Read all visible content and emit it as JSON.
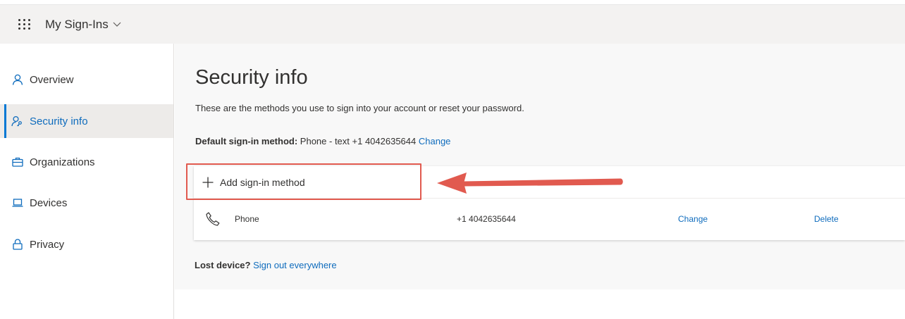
{
  "header": {
    "app_title": "My Sign-Ins"
  },
  "sidebar": {
    "items": [
      {
        "label": "Overview",
        "icon": "person-icon",
        "active": false
      },
      {
        "label": "Security info",
        "icon": "person-key-icon",
        "active": true
      },
      {
        "label": "Organizations",
        "icon": "briefcase-icon",
        "active": false
      },
      {
        "label": "Devices",
        "icon": "laptop-icon",
        "active": false
      },
      {
        "label": "Privacy",
        "icon": "lock-icon",
        "active": false
      }
    ]
  },
  "main": {
    "title": "Security info",
    "subtitle": "These are the methods you use to sign into your account or reset your password.",
    "default_method": {
      "label": "Default sign-in method:",
      "value": "Phone - text +1 4042635644",
      "change_link": "Change"
    },
    "add_method_label": "Add sign-in method",
    "methods": [
      {
        "icon": "phone-icon",
        "type": "Phone",
        "value": "+1 4042635644",
        "change": "Change",
        "delete": "Delete"
      }
    ],
    "lost_device": {
      "label": "Lost device?",
      "link": "Sign out everywhere"
    }
  },
  "annotation": {
    "highlight_color": "#e15a4f",
    "arrow_color": "#e15a4f"
  },
  "colors": {
    "accent": "#0078d4",
    "link": "#0f6cbd",
    "header_bg": "#f3f2f1",
    "content_bg": "#f8f8f8"
  }
}
